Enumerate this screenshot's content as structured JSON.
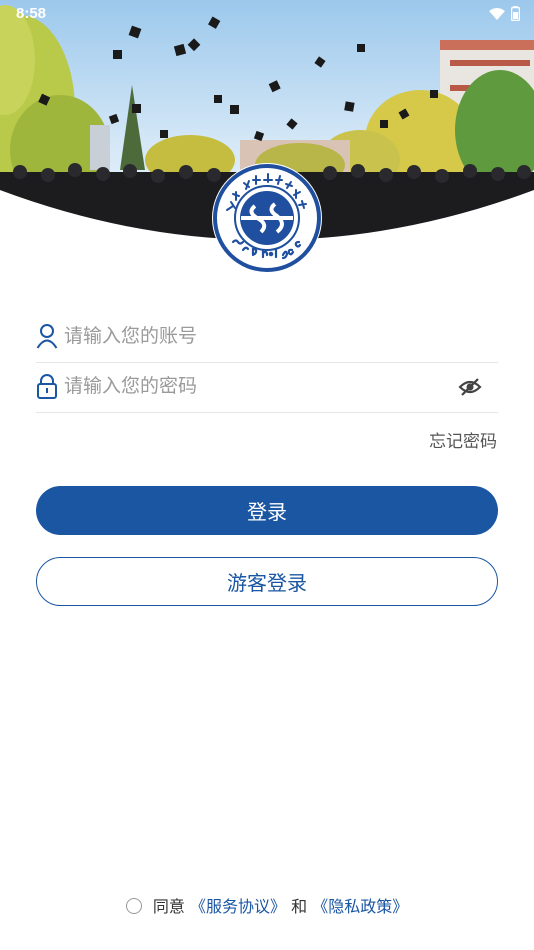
{
  "status_bar": {
    "time": "8:58"
  },
  "emblem": {
    "text_top": "四川工程职业技术大学",
    "text_bottom": "SCPU·1959"
  },
  "login_form": {
    "account_placeholder": "请输入您的账号",
    "password_placeholder": "请输入您的密码",
    "forgot_password": "忘记密码",
    "login_button": "登录",
    "guest_button": "游客登录"
  },
  "agreement": {
    "prefix": "同意",
    "service_link": "《服务协议》",
    "connector": "和",
    "privacy_link": "《隐私政策》"
  },
  "colors": {
    "primary": "#1b56a3",
    "emblem_blue": "#1f4f9e",
    "text_muted": "#9a9a9a"
  },
  "icons": {
    "account": "user-icon",
    "password": "lock-icon",
    "toggle": "eye-off-icon",
    "wifi": "wifi-icon",
    "battery": "battery-icon"
  }
}
